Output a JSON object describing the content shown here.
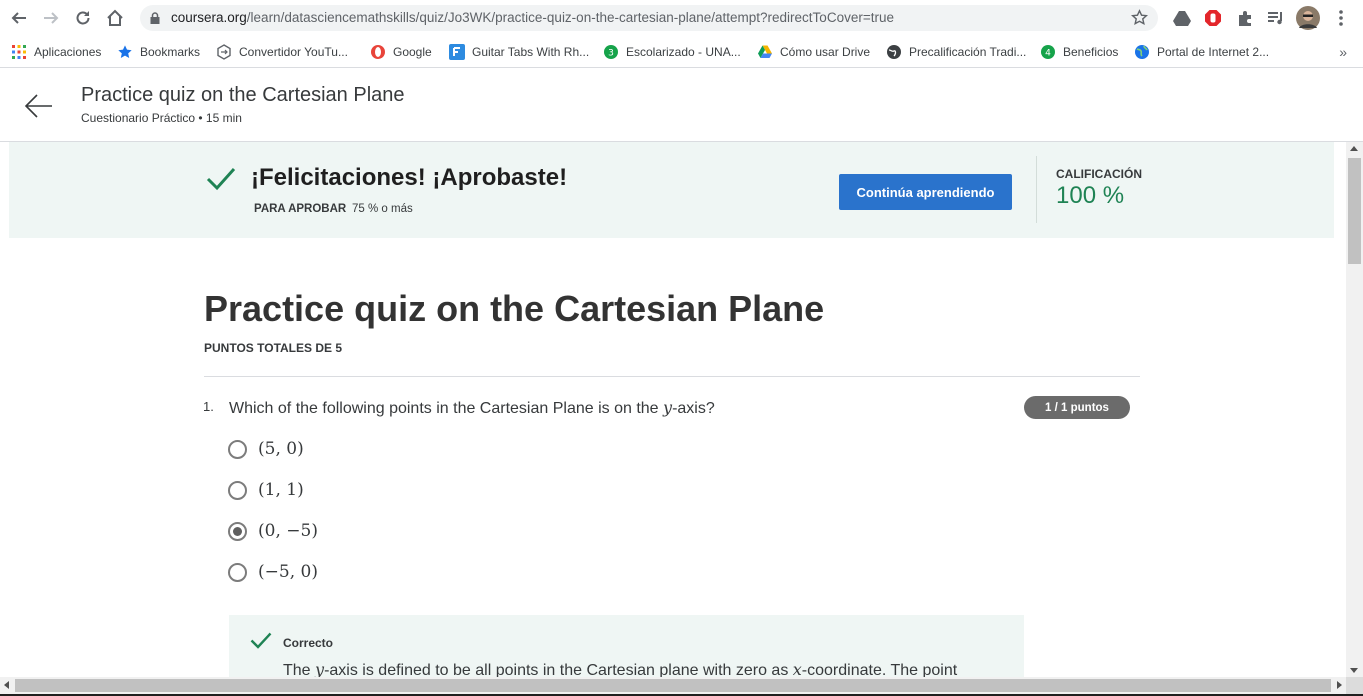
{
  "browser": {
    "url_host": "coursera.org",
    "url_path": "/learn/datasciencemathskills/quiz/Jo3WK/practice-quiz-on-the-cartesian-plane/attempt?redirectToCover=true",
    "bookmarks": [
      {
        "label": "Aplicaciones",
        "icon": "apps-grid-icon",
        "color": "#4285f4"
      },
      {
        "label": "Bookmarks",
        "icon": "star-icon",
        "color": "#1a73e8"
      },
      {
        "label": "Convertidor YouTu...",
        "icon": "converter-icon",
        "color": "#5f6368"
      },
      {
        "label": "Google",
        "icon": "opera-icon",
        "color": "#e8443a"
      },
      {
        "label": "Guitar Tabs With Rh...",
        "icon": "guitar-tabs-icon",
        "color": "#2d8be0"
      },
      {
        "label": "Escolarizado - UNA...",
        "icon": "escolarizado-icon",
        "color": "#16a34a"
      },
      {
        "label": "Cómo usar Drive",
        "icon": "drive-icon",
        "color": "#f4b400"
      },
      {
        "label": "Precalificación Tradi...",
        "icon": "globe-dark-icon",
        "color": "#3c4043"
      },
      {
        "label": "Beneficios",
        "icon": "beneficios-icon",
        "color": "#16a34a"
      },
      {
        "label": "Portal de Internet 2...",
        "icon": "globe-icon",
        "color": "#1a73e8"
      }
    ],
    "more_bookmarks": "»"
  },
  "header": {
    "title": "Practice quiz on the Cartesian Plane",
    "subtitle": "Cuestionario Práctico • 15 min"
  },
  "banner": {
    "title": "¡Felicitaciones! ¡Aprobaste!",
    "pass_label": "PARA APROBAR",
    "pass_value": "75 % o más",
    "continue_label": "Continúa aprendiendo",
    "grade_label": "CALIFICACIÓN",
    "grade_value": "100 %",
    "accent_color": "#1f8354",
    "button_color": "#2a73cc"
  },
  "quiz": {
    "title": "Practice quiz on the Cartesian Plane",
    "total_points": "PUNTOS TOTALES DE 5",
    "questions": [
      {
        "number": "1.",
        "text_before": "Which of the following points in the Cartesian Plane is on the ",
        "text_var": "y",
        "text_after": "-axis?",
        "score_badge": "1 / 1 puntos",
        "options": [
          {
            "label": "(5, 0)",
            "selected": false
          },
          {
            "label": "(1, 1)",
            "selected": false
          },
          {
            "label": "(0, −5)",
            "selected": true
          },
          {
            "label": "(−5, 0)",
            "selected": false
          }
        ],
        "feedback": {
          "label": "Correcto",
          "text_1": "The ",
          "var_1": "y",
          "text_2": "-axis is defined to be all points in the Cartesian plane with zero as ",
          "var_2": "x",
          "text_3": "-coordinate. The point"
        }
      }
    ]
  }
}
